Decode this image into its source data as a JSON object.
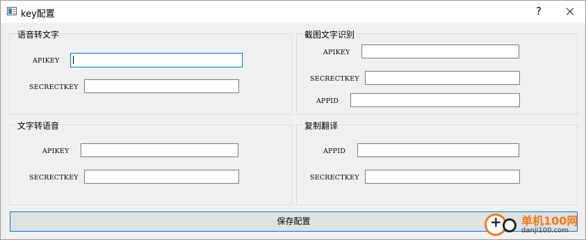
{
  "window": {
    "title": "key配置",
    "help_label": "?"
  },
  "groups": {
    "speech_to_text": {
      "title": "语音转文字",
      "apikey_label": "APIKEY",
      "apikey_value": "",
      "secretkey_label": "SECRECTKEY",
      "secretkey_value": ""
    },
    "screenshot_ocr": {
      "title": "截图文字识别",
      "apikey_label": "APIKEY",
      "apikey_value": "",
      "secretkey_label": "SECRECTKEY",
      "secretkey_value": "",
      "appid_label": "APPID",
      "appid_value": ""
    },
    "text_to_speech": {
      "title": "文字转语音",
      "apikey_label": "APIKEY",
      "apikey_value": "",
      "secretkey_label": "SECRECTKEY",
      "secretkey_value": ""
    },
    "copy_translate": {
      "title": "复制翻译",
      "appid_label": "APPID",
      "appid_value": "",
      "secretkey_label": "SECRECTKEY",
      "secretkey_value": ""
    }
  },
  "save_button_label": "保存配置",
  "watermark": {
    "name": "单机100网",
    "url": "danji100.com"
  },
  "colors": {
    "accent": "#0078d7",
    "window_bg": "#f0f0f0",
    "watermark_orange": "#f07a1b"
  }
}
